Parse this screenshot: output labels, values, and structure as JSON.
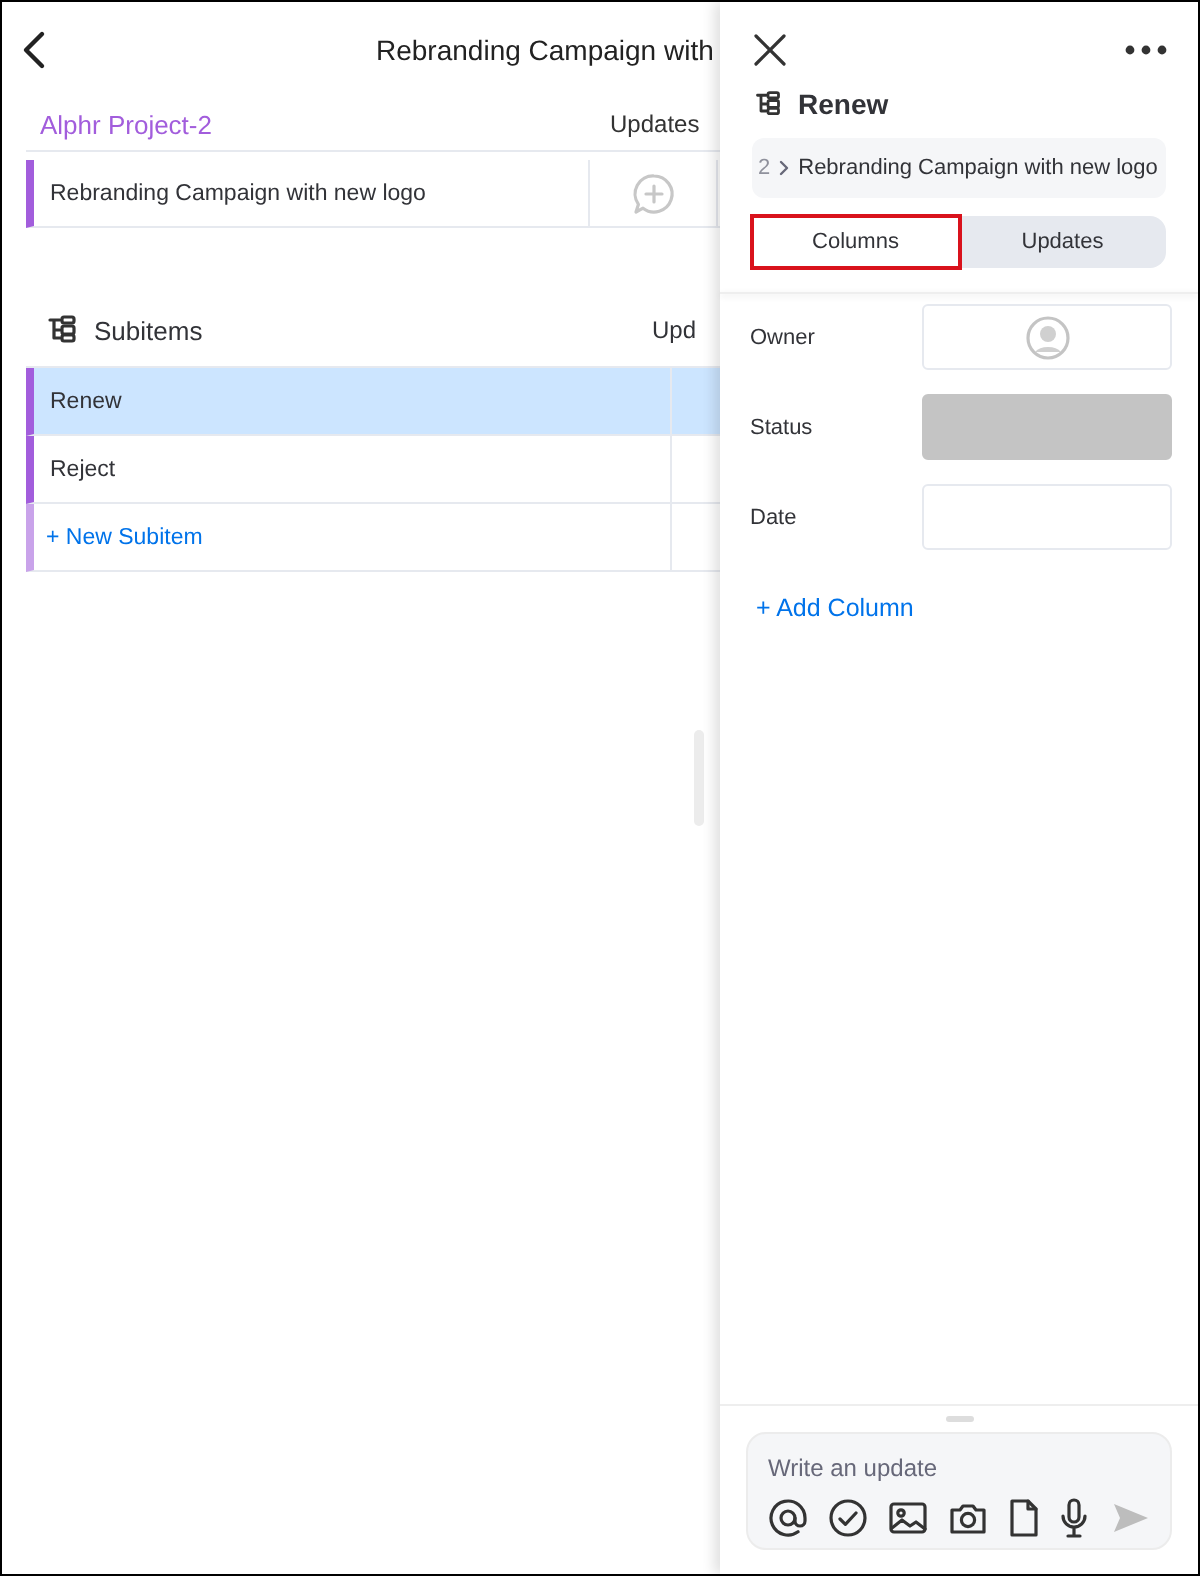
{
  "board": {
    "title": "Rebranding Campaign with",
    "group": {
      "name": "Alphr Project-2",
      "column": "Updates",
      "items": [
        {
          "name": "Rebranding Campaign with new logo"
        }
      ]
    },
    "subitems": {
      "title": "Subitems",
      "column": "Upd",
      "rows": [
        {
          "name": "Renew",
          "selected": true
        },
        {
          "name": "Reject",
          "selected": false
        }
      ],
      "add_label": "+ New Subitem"
    }
  },
  "panel": {
    "title": "Renew",
    "breadcrumb": {
      "number": "2",
      "item": "Rebranding Campaign with new logo"
    },
    "tabs": [
      {
        "label": "Columns",
        "selected": true,
        "highlighted": true
      },
      {
        "label": "Updates",
        "selected": false,
        "highlighted": false
      }
    ],
    "columns": [
      {
        "label": "Owner",
        "kind": "person"
      },
      {
        "label": "Status",
        "kind": "status"
      },
      {
        "label": "Date",
        "kind": "date"
      }
    ],
    "add_column": "+ Add Column",
    "composer": {
      "placeholder": "Write an update"
    }
  }
}
